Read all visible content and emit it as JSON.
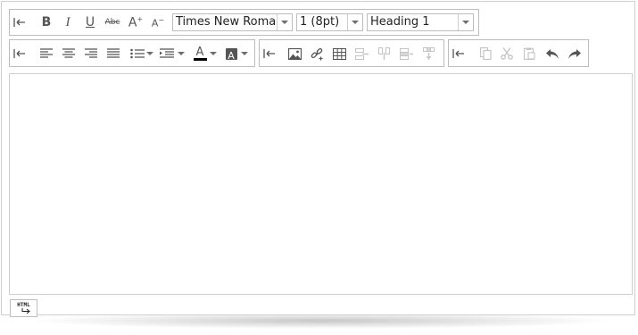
{
  "toolbar": {
    "font_name": {
      "value": "Times New Roman"
    },
    "font_size": {
      "value": "1 (8pt)"
    },
    "paragraph_format": {
      "value": "Heading 1"
    },
    "bold_glyph": "B",
    "italic_glyph": "I",
    "underline_glyph": "U",
    "strike_glyph": "Abc",
    "grow_glyph": "A",
    "shrink_glyph": "A",
    "fore_color_glyph": "A",
    "back_color_glyph": "A",
    "colors": {
      "fore_color": "#000000",
      "back_color": "#ffffff",
      "icon": "#555555",
      "icon_disabled": "#bdbdbd"
    }
  },
  "footer": {
    "html_view_label": "HTML"
  }
}
